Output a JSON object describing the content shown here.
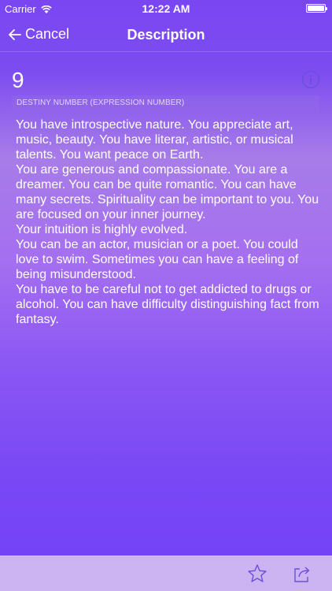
{
  "status_bar": {
    "carrier": "Carrier",
    "time": "12:22 AM"
  },
  "nav": {
    "cancel_label": "Cancel",
    "title": "Description"
  },
  "content": {
    "number": "9",
    "subtitle": "DESTINY NUMBER (EXPRESSION NUMBER)",
    "paragraphs": [
      "You have introspective nature. You appreciate art, music, beauty. You have literar, artistic, or musical talents. You want peace on Earth.",
      "You are generous and compassionate. You are a dreamer. You can be quite romantic. You can have many secrets. Spirituality can be important to you. You are focused on your inner journey.",
      "Your intuition is highly evolved.",
      "You can be an actor, musician or a poet. You could love to swim. Sometimes you can have a feeling of being misunderstood.",
      "You have to be careful not to get addicted to drugs or alcohol. You can have difficulty distinguishing fact from fantasy."
    ]
  },
  "icons": {
    "back": "arrow-left-icon",
    "info": "info-icon",
    "favorite": "star-icon",
    "share": "share-icon",
    "wifi": "wifi-icon",
    "battery": "battery-icon"
  },
  "colors": {
    "accent": "#7a46f2",
    "toolbar": "#cbb4f1",
    "icon_tint": "#6b4fd8"
  }
}
